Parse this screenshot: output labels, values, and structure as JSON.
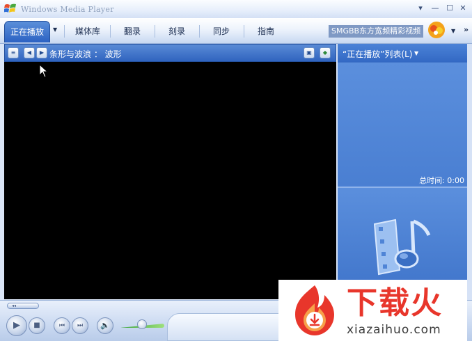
{
  "window": {
    "title": "Windows Media Player",
    "controls": {
      "minimize": "▾",
      "restore": "—",
      "maximize": "☐",
      "close": "✕"
    }
  },
  "tabs": [
    {
      "label": "正在播放",
      "active": true
    },
    {
      "label": "媒体库",
      "active": false
    },
    {
      "label": "翻录",
      "active": false
    },
    {
      "label": "刻录",
      "active": false
    },
    {
      "label": "同步",
      "active": false
    },
    {
      "label": "指南",
      "active": false
    }
  ],
  "tab_dropdown_icon": "chevron-down-icon",
  "stream": {
    "label": "SMGBB东方宽频精彩视频"
  },
  "tab_more_icon": "»",
  "viz_toolbar": {
    "label": "条形与波浪 ： 波形"
  },
  "playlist": {
    "title": "“正在播放”列表(L)",
    "total_time": "总时间: 0:00"
  },
  "controls": {
    "play_icon": "play-icon",
    "stop_icon": "stop-icon",
    "prev_icon": "previous-icon",
    "next_icon": "next-icon",
    "mute_icon": "speaker-icon"
  },
  "watermark": {
    "title": "下载火",
    "url": "xiazaihuo.com"
  },
  "colors": {
    "accent": "#3064bf",
    "playlist_bg": "#4a80d4",
    "watermark_red": "#e8362b"
  }
}
